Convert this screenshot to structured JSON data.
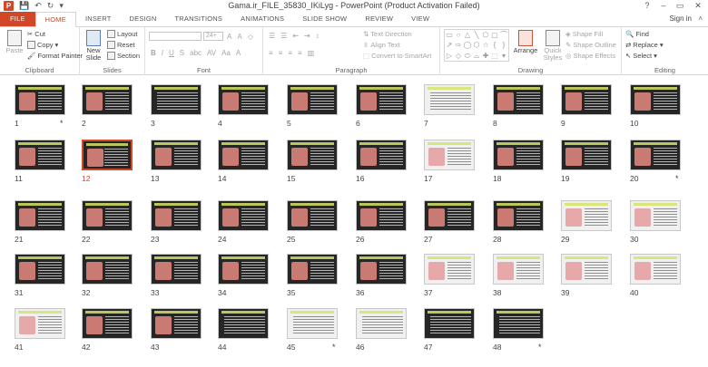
{
  "titlebar": {
    "title": "Gama.ir_FILE_35830_IKiLyg - PowerPoint (Product Activation Failed)",
    "app_icon": "P",
    "qat": [
      "save-icon",
      "undo-icon",
      "redo-icon",
      "customize-icon"
    ],
    "help": "?",
    "minimize": "–",
    "restore": "▭",
    "close": "✕"
  },
  "tabs": [
    "FILE",
    "HOME",
    "INSERT",
    "DESIGN",
    "TRANSITIONS",
    "ANIMATIONS",
    "SLIDE SHOW",
    "REVIEW",
    "VIEW"
  ],
  "active_tab": "HOME",
  "signin": "Sign in",
  "ribbon": {
    "clipboard": {
      "label": "Clipboard",
      "paste": "Paste",
      "cut": "Cut",
      "copy": "Copy",
      "format_painter": "Format Painter"
    },
    "slides": {
      "label": "Slides",
      "new_slide": "New Slide",
      "layout": "Layout",
      "reset": "Reset",
      "section": "Section"
    },
    "font": {
      "label": "Font",
      "size": "24+",
      "bold": "B",
      "italic": "I",
      "underline": "U",
      "strike": "S",
      "shadow": "abc",
      "spacing": "AV",
      "case": "Aa"
    },
    "paragraph": {
      "label": "Paragraph",
      "text_direction": "Text Direction",
      "align_text": "Align Text",
      "smartart": "Convert to SmartArt"
    },
    "drawing": {
      "label": "Drawing",
      "arrange": "Arrange",
      "quick_styles": "Quick Styles",
      "shape_fill": "Shape Fill",
      "shape_outline": "Shape Outline",
      "shape_effects": "Shape Effects"
    },
    "editing": {
      "label": "Editing",
      "find": "Find",
      "replace": "Replace",
      "select": "Select"
    }
  },
  "slides": [
    {
      "n": "1",
      "star": true
    },
    {
      "n": "2"
    },
    {
      "n": "3"
    },
    {
      "n": "4"
    },
    {
      "n": "5"
    },
    {
      "n": "6"
    },
    {
      "n": "7"
    },
    {
      "n": "8"
    },
    {
      "n": "9"
    },
    {
      "n": "10"
    },
    {
      "n": "11"
    },
    {
      "n": "12",
      "selected": true
    },
    {
      "n": "13"
    },
    {
      "n": "14"
    },
    {
      "n": "15"
    },
    {
      "n": "16"
    },
    {
      "n": "17"
    },
    {
      "n": "18"
    },
    {
      "n": "19"
    },
    {
      "n": "20",
      "star": true
    },
    {
      "n": "21"
    },
    {
      "n": "22"
    },
    {
      "n": "23"
    },
    {
      "n": "24"
    },
    {
      "n": "25"
    },
    {
      "n": "26"
    },
    {
      "n": "27"
    },
    {
      "n": "28"
    },
    {
      "n": "29"
    },
    {
      "n": "30"
    },
    {
      "n": "31"
    },
    {
      "n": "32"
    },
    {
      "n": "33"
    },
    {
      "n": "34"
    },
    {
      "n": "35"
    },
    {
      "n": "36"
    },
    {
      "n": "37"
    },
    {
      "n": "38"
    },
    {
      "n": "39"
    },
    {
      "n": "40"
    },
    {
      "n": "41"
    },
    {
      "n": "42"
    },
    {
      "n": "43"
    },
    {
      "n": "44"
    },
    {
      "n": "45",
      "star": true
    },
    {
      "n": "46"
    },
    {
      "n": "47"
    },
    {
      "n": "48",
      "star": true
    }
  ],
  "colors": {
    "accent": "#d24726",
    "slide_bg": "#262626"
  }
}
